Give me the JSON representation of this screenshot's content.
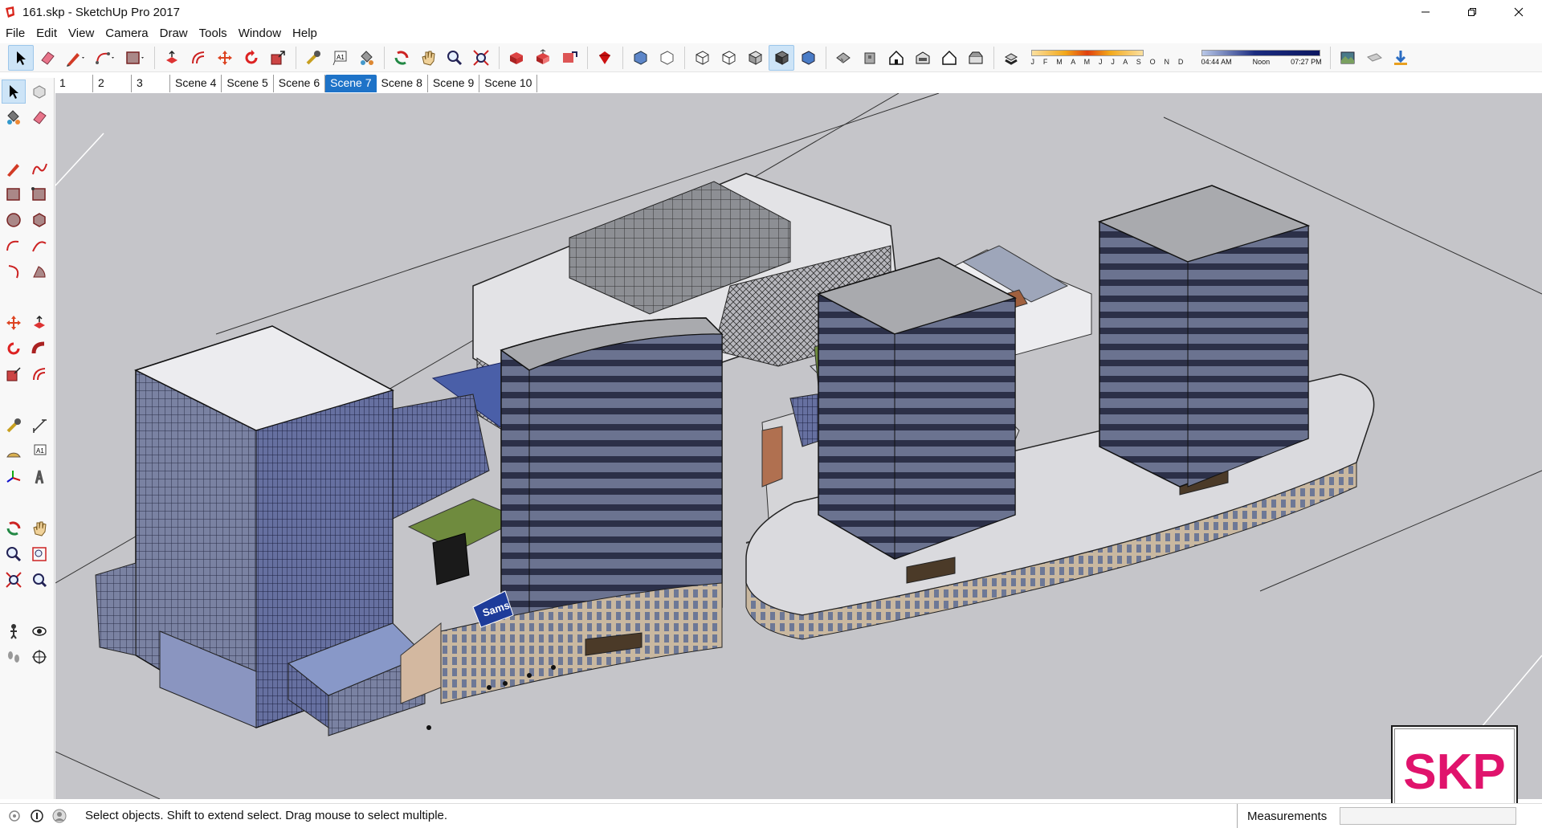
{
  "window": {
    "title": "161.skp - SketchUp Pro 2017",
    "controls": [
      "minimize-icon",
      "restore-icon",
      "close-icon"
    ]
  },
  "menu": [
    "File",
    "Edit",
    "View",
    "Camera",
    "Draw",
    "Tools",
    "Window",
    "Help"
  ],
  "toolbar": {
    "shadow_months": "J F M A M J J A S O N D",
    "time_start": "04:44 AM",
    "time_mid": "Noon",
    "time_end": "07:27 PM"
  },
  "scenes": {
    "tabs": [
      "1",
      "2",
      "3",
      "Scene 4",
      "Scene 5",
      "Scene 6",
      "Scene 7",
      "Scene 8",
      "Scene 9",
      "Scene 10"
    ],
    "active": "Scene 7"
  },
  "viewport": {
    "sign_text": "Sams",
    "logo_text": "SKP",
    "colors": {
      "ground": "#c5c5c9",
      "tower_glass": "#6c7594",
      "roof": "#b8b8bc",
      "logo": "#e0136c"
    }
  },
  "status": {
    "message": "Select objects. Shift to extend select. Drag mouse to select multiple.",
    "measurements_label": "Measurements",
    "measurements_value": ""
  }
}
